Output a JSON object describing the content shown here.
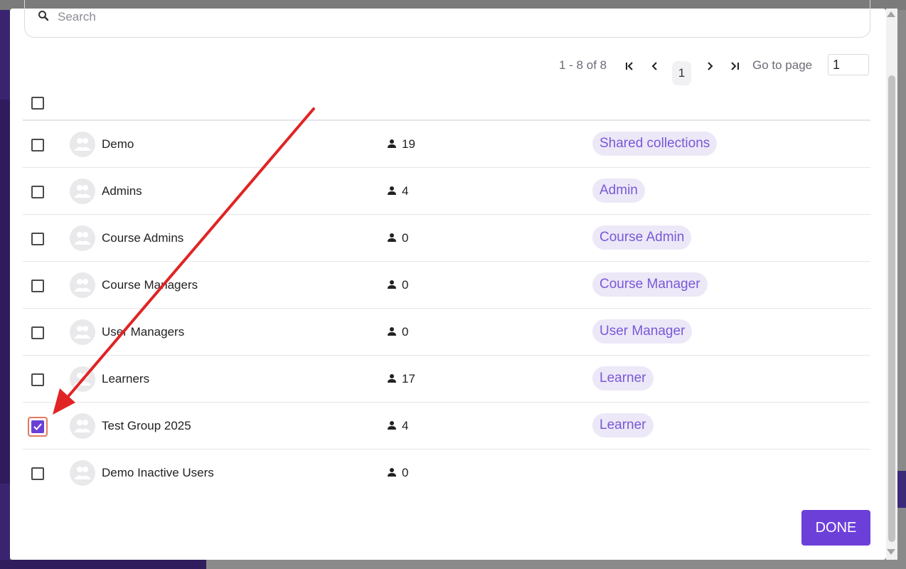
{
  "search": {
    "placeholder": "Search",
    "value": ""
  },
  "pagination": {
    "range_text": "1 - 8 of 8",
    "current_page": "1",
    "go_to_label": "Go to page",
    "go_to_value": "1"
  },
  "groups": [
    {
      "name": "Demo",
      "count": "19",
      "tag": "Shared collections",
      "checked": false
    },
    {
      "name": "Admins",
      "count": "4",
      "tag": "Admin",
      "checked": false
    },
    {
      "name": "Course Admins",
      "count": "0",
      "tag": "Course Admin",
      "checked": false
    },
    {
      "name": "Course Managers",
      "count": "0",
      "tag": "Course Manager",
      "checked": false
    },
    {
      "name": "User Managers",
      "count": "0",
      "tag": "User Manager",
      "checked": false
    },
    {
      "name": "Learners",
      "count": "17",
      "tag": "Learner",
      "checked": false
    },
    {
      "name": "Test Group 2025",
      "count": "4",
      "tag": "Learner",
      "checked": true
    },
    {
      "name": "Demo Inactive Users",
      "count": "0",
      "tag": "",
      "checked": false
    }
  ],
  "done_label": "DONE",
  "colors": {
    "accent": "#6d3fd9",
    "tag_bg": "#ece8f7",
    "tag_text": "#7a58d8",
    "annotation_arrow": "#e02424"
  }
}
